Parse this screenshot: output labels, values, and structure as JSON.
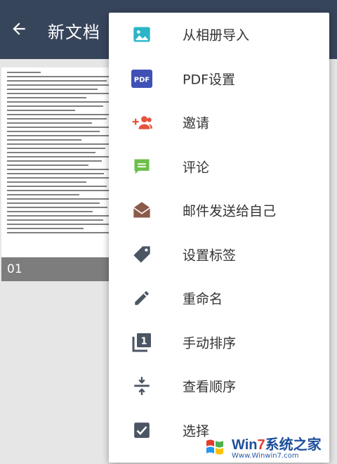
{
  "appbar": {
    "title": "新文档"
  },
  "document": {
    "page_label": "01"
  },
  "menu": {
    "items": [
      {
        "label": "从相册导入",
        "icon": "image-icon"
      },
      {
        "label": "PDF设置",
        "icon": "pdf-icon",
        "badge": "PDF"
      },
      {
        "label": "邀请",
        "icon": "add-people-icon"
      },
      {
        "label": "评论",
        "icon": "comment-icon"
      },
      {
        "label": "邮件发送给自己",
        "icon": "mail-open-icon"
      },
      {
        "label": "设置标签",
        "icon": "tag-icon"
      },
      {
        "label": "重命名",
        "icon": "pencil-icon"
      },
      {
        "label": "手动排序",
        "icon": "manual-sort-icon",
        "badge": "1"
      },
      {
        "label": "查看顺序",
        "icon": "view-order-icon"
      },
      {
        "label": "选择",
        "icon": "checkbox-icon"
      }
    ]
  },
  "watermark": {
    "title_a": "Win",
    "title_b": "7",
    "title_c": "系统之家",
    "url": "Www.Winwin7.com"
  },
  "colors": {
    "appbar": "#37455b",
    "accent_teal": "#2bb5c5",
    "pdf_blue": "#3f51b5",
    "invite_red": "#e5533d",
    "comment_green": "#6cbf4a",
    "mail_brown": "#8b5a4a",
    "icon_gray": "#4b5563"
  }
}
